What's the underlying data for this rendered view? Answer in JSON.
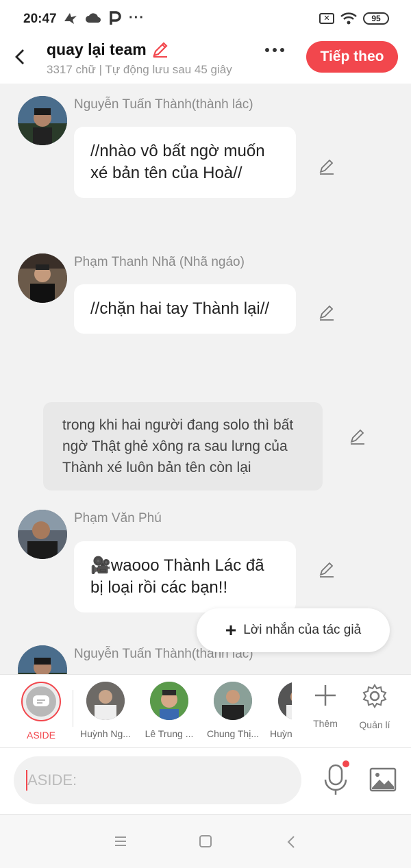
{
  "status_bar": {
    "time": "20:47",
    "battery": "95",
    "left_icons": [
      "shark-icon",
      "cloud-icon",
      "p-icon",
      "more-dots-icon"
    ],
    "right_icons": [
      "x-box-icon",
      "wifi-icon",
      "battery-icon"
    ]
  },
  "header": {
    "title": "quay lại team",
    "subtitle": "3317 chữ | Tự động lưu sau 45 giây",
    "next_label": "Tiếp theo",
    "accent": "#f2474d"
  },
  "messages": [
    {
      "name": "Nguyễn Tuấn Thành(thành lác)",
      "text": "//nhào vô bất ngờ muốn xé bản tên của Hoà//"
    },
    {
      "name": "Phạm Thanh Nhã (Nhã ngáo)",
      "text": "//chặn hai tay Thành lại//"
    },
    {
      "narration": "trong khi hai người đang solo thì bất ngờ Thật ghẻ xông ra sau lưng của Thành xé luôn bản tên còn lại"
    },
    {
      "name": "Phạm Văn Phú",
      "text": "🎥waooo Thành Lác đã bị loại rồi các bạn!!"
    },
    {
      "name": "Nguyễn Tuấn Thành(thành lác)"
    }
  ],
  "author_note": "Lời nhắn của tác giả",
  "characters": [
    {
      "label": "ASIDE"
    },
    {
      "label": "Huỳnh Ng..."
    },
    {
      "label": "Lê Trung ..."
    },
    {
      "label": "Chung Thị..."
    },
    {
      "label": "Huỳnh"
    }
  ],
  "tools": {
    "add_label": "Thêm",
    "manage_label": "Quản lí"
  },
  "input": {
    "placeholder": "ASIDE:"
  }
}
